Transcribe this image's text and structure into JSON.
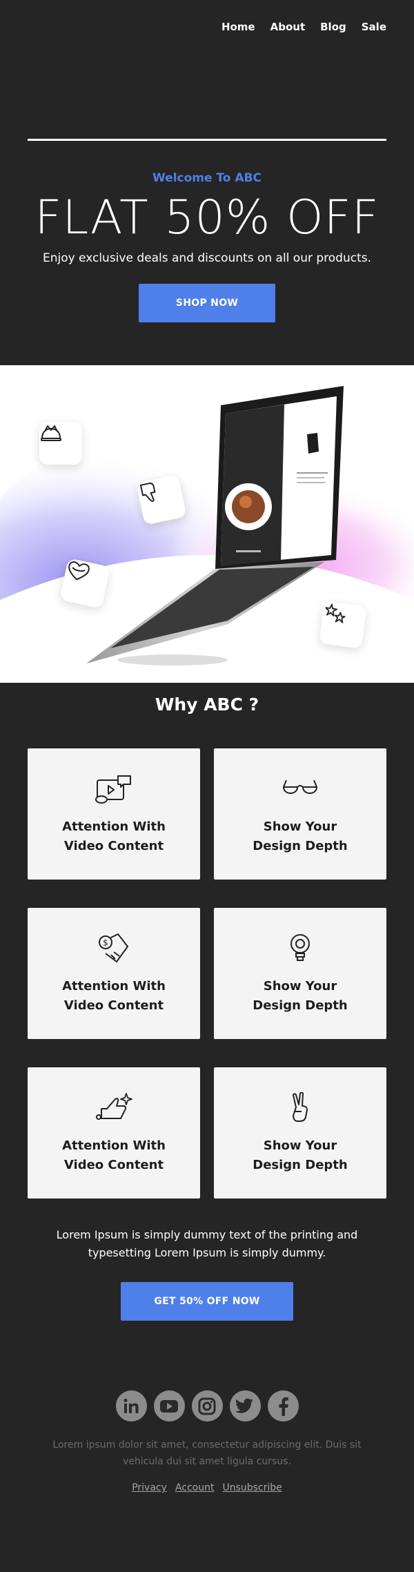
{
  "nav": {
    "items": [
      {
        "label": "Home"
      },
      {
        "label": "About"
      },
      {
        "label": "Blog"
      },
      {
        "label": "Sale"
      }
    ]
  },
  "hero": {
    "welcome": "Welcome To ABC",
    "title": "FLAT 50% OFF",
    "subtitle": "Enjoy exclusive deals and discounts on all our products.",
    "cta_label": "SHOP NOW"
  },
  "why": {
    "title": "Why ABC ?",
    "cards": [
      {
        "line1": "Attention With",
        "line2": "Video Content",
        "icon": "video-chat-icon"
      },
      {
        "line1": "Show Your",
        "line2": "Design Depth",
        "icon": "glasses-icon"
      },
      {
        "line1": "Attention With",
        "line2": "Video Content",
        "icon": "money-hand-icon"
      },
      {
        "line1": "Show Your",
        "line2": "Design Depth",
        "icon": "lightbulb-icon"
      },
      {
        "line1": "Attention With",
        "line2": "Video Content",
        "icon": "thumbs-up-sparkle-icon"
      },
      {
        "line1": "Show Your",
        "line2": "Design Depth",
        "icon": "peace-hand-icon"
      }
    ]
  },
  "body_text": "Lorem Ipsum is simply dummy text of the printing and typesetting Lorem Ipsum is simply dummy.",
  "offer_cta_label": "GET 50% OFF NOW",
  "footer": {
    "social": [
      "linkedin-icon",
      "youtube-icon",
      "instagram-icon",
      "twitter-icon",
      "facebook-icon"
    ],
    "text": "Lorem ipsum dolor sit amet, consectetur adipiscing elit. Duis sit vehicula dui sit amet ligula cursus.",
    "links": [
      {
        "label": "Privacy"
      },
      {
        "label": "Account"
      },
      {
        "label": "Unsubscribe"
      }
    ]
  },
  "colors": {
    "background": "#252525",
    "accent": "#4f7fe8",
    "card": "#f4f4f4",
    "social": "#8c8c8c"
  }
}
